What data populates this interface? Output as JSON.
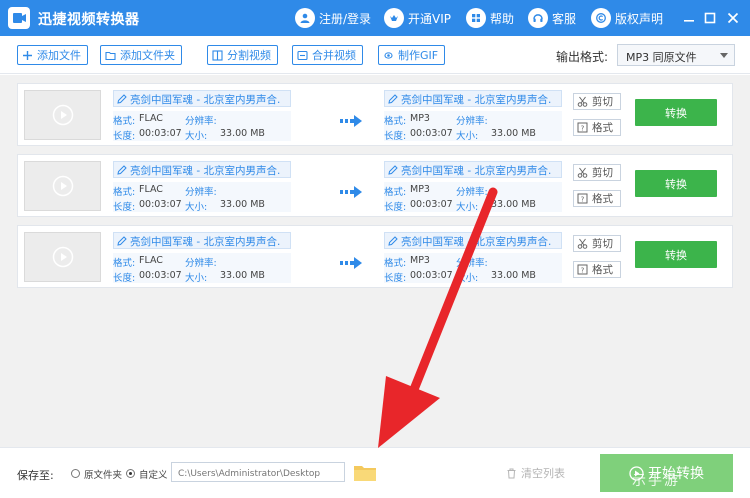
{
  "app": {
    "title": "迅捷视频转换器"
  },
  "titlebar": {
    "items": [
      {
        "label": "注册/登录",
        "icon": "user-icon"
      },
      {
        "label": "开通VIP",
        "icon": "vip-icon"
      },
      {
        "label": "帮助",
        "icon": "help-icon"
      },
      {
        "label": "客服",
        "icon": "headset-icon"
      },
      {
        "label": "版权声明",
        "icon": "copyright-icon"
      }
    ],
    "window_buttons": [
      "minimize-icon",
      "maximize-icon",
      "close-icon"
    ]
  },
  "toolbar": {
    "add_file": "添加文件",
    "add_folder": "添加文件夹",
    "split_video": "分割视频",
    "merge_video": "合并视频",
    "make_gif": "制作GIF",
    "output_format_label": "输出格式:",
    "output_format_value": "MP3  同原文件"
  },
  "files": [
    {
      "source": {
        "name": "亮剑中国军魂 - 北京室内男声合.",
        "format_label": "格式:",
        "format": "FLAC",
        "res_label": "分辨率:",
        "resolution": "",
        "duration_label": "长度:",
        "duration": "00:03:07",
        "size_label": "大小:",
        "size": "33.00 MB"
      },
      "target": {
        "name": "亮剑中国军魂 - 北京室内男声合.",
        "format_label": "格式:",
        "format": "MP3",
        "res_label": "分辨率:",
        "resolution": "",
        "duration_label": "长度:",
        "duration": "00:03:07",
        "size_label": "大小:",
        "size": "33.00 MB"
      },
      "cut_label": "剪切",
      "format_btn_label": "格式",
      "convert_label": "转换"
    },
    {
      "source": {
        "name": "亮剑中国军魂 - 北京室内男声合.",
        "format_label": "格式:",
        "format": "FLAC",
        "res_label": "分辨率:",
        "resolution": "",
        "duration_label": "长度:",
        "duration": "00:03:07",
        "size_label": "大小:",
        "size": "33.00 MB"
      },
      "target": {
        "name": "亮剑中国军魂 - 北京室内男声合.",
        "format_label": "格式:",
        "format": "MP3",
        "res_label": "分辨率:",
        "resolution": "",
        "duration_label": "长度:",
        "duration": "00:03:07",
        "size_label": "大小:",
        "size": "33.00 MB"
      },
      "cut_label": "剪切",
      "format_btn_label": "格式",
      "convert_label": "转换"
    },
    {
      "source": {
        "name": "亮剑中国军魂 - 北京室内男声合.",
        "format_label": "格式:",
        "format": "FLAC",
        "res_label": "分辨率:",
        "resolution": "",
        "duration_label": "长度:",
        "duration": "00:03:07",
        "size_label": "大小:",
        "size": "33.00 MB"
      },
      "target": {
        "name": "亮剑中国军魂 - 北京室内男声合.",
        "format_label": "格式:",
        "format": "MP3",
        "res_label": "分辨率:",
        "resolution": "",
        "duration_label": "长度:",
        "duration": "00:03:07",
        "size_label": "大小:",
        "size": "33.00 MB"
      },
      "cut_label": "剪切",
      "format_btn_label": "格式",
      "convert_label": "转换"
    }
  ],
  "bottom": {
    "save_to_label": "保存至:",
    "option_original": "原文件夹",
    "option_custom": "自定义",
    "path_placeholder": "C:\\Users\\Administrator\\Desktop",
    "clear_list": "清空列表",
    "start_convert": "开始转换",
    "watermark": "示手游"
  },
  "colors": {
    "accent": "#2f8ae8",
    "convert_green": "#3cb44b",
    "start_green": "#7fd07b",
    "annotation_red": "#e8262a"
  }
}
